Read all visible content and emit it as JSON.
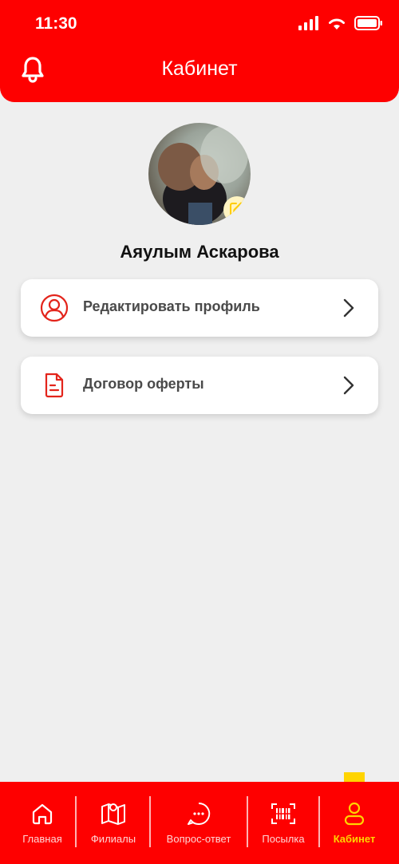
{
  "status_bar": {
    "time": "11:30"
  },
  "header": {
    "title": "Кабинет"
  },
  "profile": {
    "name": "Аяулым Аскарова"
  },
  "menu": [
    {
      "label": "Редактировать профиль",
      "icon": "user-icon"
    },
    {
      "label": "Договор оферты",
      "icon": "document-icon"
    }
  ],
  "tabbar": {
    "items": [
      {
        "label": "Главная",
        "icon": "home-icon",
        "active": false
      },
      {
        "label": "Филиалы",
        "icon": "map-icon",
        "active": false
      },
      {
        "label": "Вопрос-ответ",
        "icon": "chat-icon",
        "active": false
      },
      {
        "label": "Посылка",
        "icon": "barcode-icon",
        "active": false
      },
      {
        "label": "Кабинет",
        "icon": "user-icon",
        "active": true
      }
    ]
  },
  "colors": {
    "brand_red": "#fe0000",
    "active_yellow": "#ffd400",
    "background": "#efefef"
  }
}
